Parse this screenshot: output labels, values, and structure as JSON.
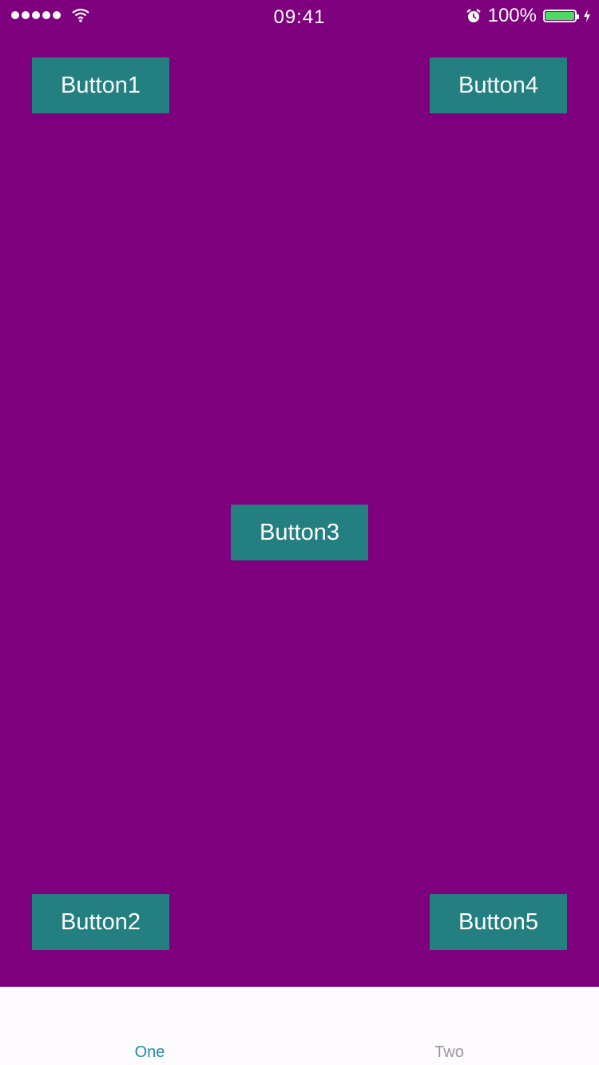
{
  "status_bar": {
    "time": "09:41",
    "battery_percent": "100%",
    "battery_level": 1.0,
    "signal_dots": 5,
    "icons": [
      "signal-icon",
      "wifi-icon",
      "alarm-icon",
      "battery-icon",
      "charging-icon"
    ]
  },
  "colors": {
    "background": "#7f007f",
    "button": "#237f80",
    "button_text": "#ffffff",
    "tab_bar": "#fdfbfd",
    "tab_active": "#1f8aa6",
    "tab_inactive": "#9a9a9a",
    "battery_fill": "#4cd964"
  },
  "buttons": {
    "button1": "Button1",
    "button2": "Button2",
    "button3": "Button3",
    "button4": "Button4",
    "button5": "Button5"
  },
  "tab_bar": {
    "tabs": [
      {
        "label": "One",
        "selected": true
      },
      {
        "label": "Two",
        "selected": false
      }
    ]
  }
}
